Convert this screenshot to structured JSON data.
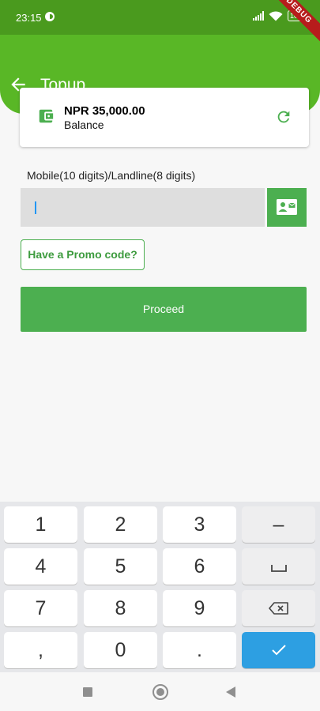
{
  "status_bar": {
    "time": "23:15",
    "battery": "100"
  },
  "debug_banner": "DEBUG",
  "app_bar": {
    "title": "Topup",
    "color": "#59b726"
  },
  "balance": {
    "amount": "NPR 35,000.00",
    "label": "Balance"
  },
  "form": {
    "field_label": "Mobile(10 digits)/Landline(8 digits)",
    "phone_value": "",
    "promo_label": "Have a Promo code?",
    "proceed_label": "Proceed"
  },
  "keypad": {
    "row1": [
      "1",
      "2",
      "3",
      "–"
    ],
    "row2": [
      "4",
      "5",
      "6",
      "space"
    ],
    "row3": [
      "7",
      "8",
      "9",
      "backspace"
    ],
    "row4": [
      ",",
      "0",
      ".",
      "done"
    ]
  },
  "colors": {
    "accent": "#4caf50",
    "keypad_done": "#2d9fe2"
  }
}
